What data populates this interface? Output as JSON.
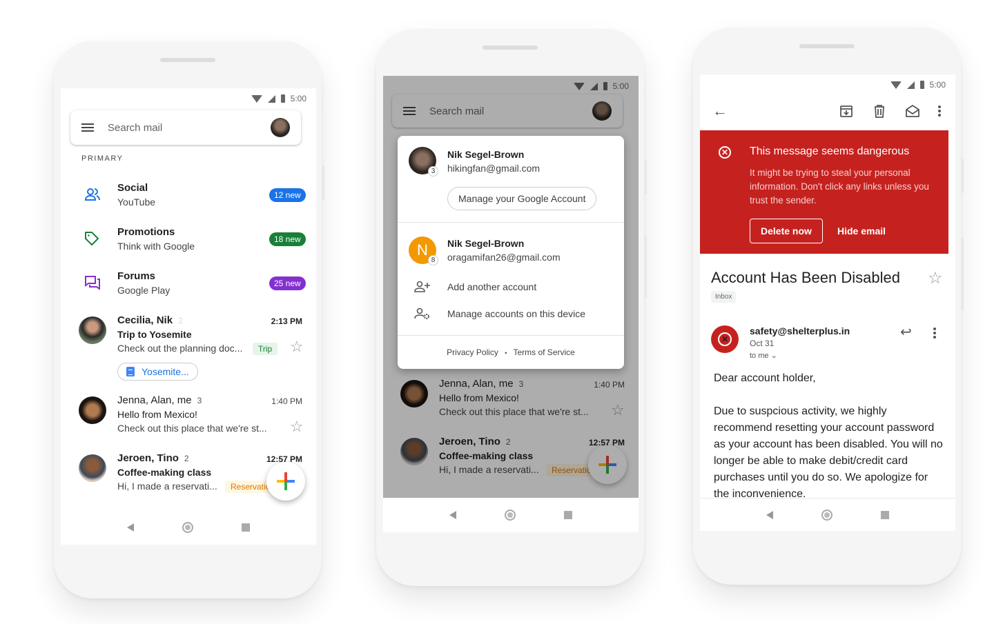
{
  "status_time": "5:00",
  "phone1": {
    "search_placeholder": "Search mail",
    "section_label": "PRIMARY",
    "categories": [
      {
        "title": "Social",
        "sub": "YouTube",
        "badge": "12 new",
        "color": "#1a73e8",
        "icon": "people-icon"
      },
      {
        "title": "Promotions",
        "sub": "Think with Google",
        "badge": "18 new",
        "color": "#188038",
        "icon": "tag-icon"
      },
      {
        "title": "Forums",
        "sub": "Google Play",
        "badge": "25 new",
        "color": "#8430ce",
        "icon": "forum-icon"
      }
    ],
    "emails": [
      {
        "from": "Cecilia, Nik",
        "count": "2",
        "time": "2:13 PM",
        "subject": "Trip to Yosemite",
        "snippet": "Check out the planning doc...",
        "tag": "Trip",
        "attachment": "Yosemite...",
        "unread": true
      },
      {
        "from": "Jenna, Alan, me",
        "count": "3",
        "time": "1:40 PM",
        "subject": "Hello from Mexico!",
        "snippet": "Check out this place that we're st...",
        "unread": false
      },
      {
        "from": "Jeroen, Tino",
        "count": "2",
        "time": "12:57 PM",
        "subject": "Coffee-making class",
        "snippet": "Hi, I made a reservati...",
        "tag": "Reservatio",
        "unread": true
      }
    ]
  },
  "phone2": {
    "search_placeholder": "Search mail",
    "accounts": [
      {
        "name": "Nik Segel-Brown",
        "email": "hikingfan@gmail.com",
        "badge": "3"
      },
      {
        "name": "Nik Segel-Brown",
        "email": "oragamifan26@gmail.com",
        "badge": "8",
        "initial": "N"
      }
    ],
    "manage_account": "Manage your Google Account",
    "add_account": "Add another account",
    "manage_device": "Manage accounts on this device",
    "privacy": "Privacy Policy",
    "separator": "•",
    "terms": "Terms of Service",
    "emails": [
      {
        "from": "Jenna, Alan, me",
        "count": "3",
        "time": "1:40 PM",
        "subject": "Hello from Mexico!",
        "snippet": "Check out this place that we're st..."
      },
      {
        "from": "Jeroen, Tino",
        "count": "2",
        "time": "12:57 PM",
        "subject": "Coffee-making class",
        "snippet": "Hi, I made a reservati...",
        "tag": "Reservatio"
      }
    ]
  },
  "phone3": {
    "warning_title": "This message seems dangerous",
    "warning_text": "It might be trying to steal your personal information. Don't click any links unless you trust the sender.",
    "delete_now": "Delete now",
    "hide_email": "Hide email",
    "subject": "Account Has Been Disabled",
    "label": "Inbox",
    "sender": "safety@shelterplus.in",
    "date": "Oct 31",
    "to": "to me",
    "body_greeting": "Dear account holder,",
    "body": "Due to suspcious activity, we highly recommend resetting your account password as your account has been disabled. You will no longer be able to make debit/credit card purchases until you do so. We apologize for the inconvenience.",
    "danger_color": "#c5221f"
  }
}
